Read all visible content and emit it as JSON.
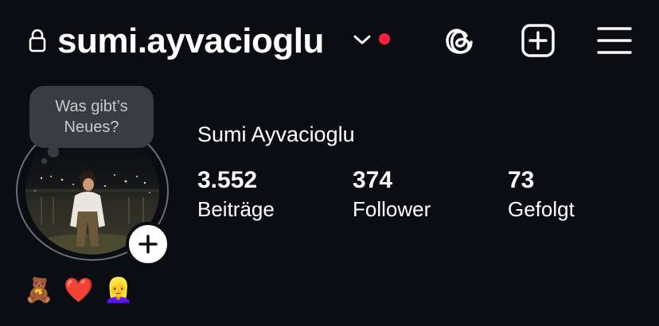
{
  "header": {
    "username": "sumi.ayvacioglu",
    "notification_color": "#ff1f3d"
  },
  "icons": [
    "lock-icon",
    "chevron-down-icon",
    "threads-icon",
    "new-post-icon",
    "menu-icon",
    "add-story-icon"
  ],
  "profile": {
    "note_bubble": "Was gibt’s Neues?",
    "full_name": "Sumi Ayvacioglu",
    "stats": [
      {
        "value": "3.552",
        "label": "Beiträge"
      },
      {
        "value": "374",
        "label": "Follower"
      },
      {
        "value": "73",
        "label": "Gefolgt"
      }
    ],
    "bio_emojis": [
      "🧸",
      "❤️",
      "👱‍♀️"
    ]
  }
}
